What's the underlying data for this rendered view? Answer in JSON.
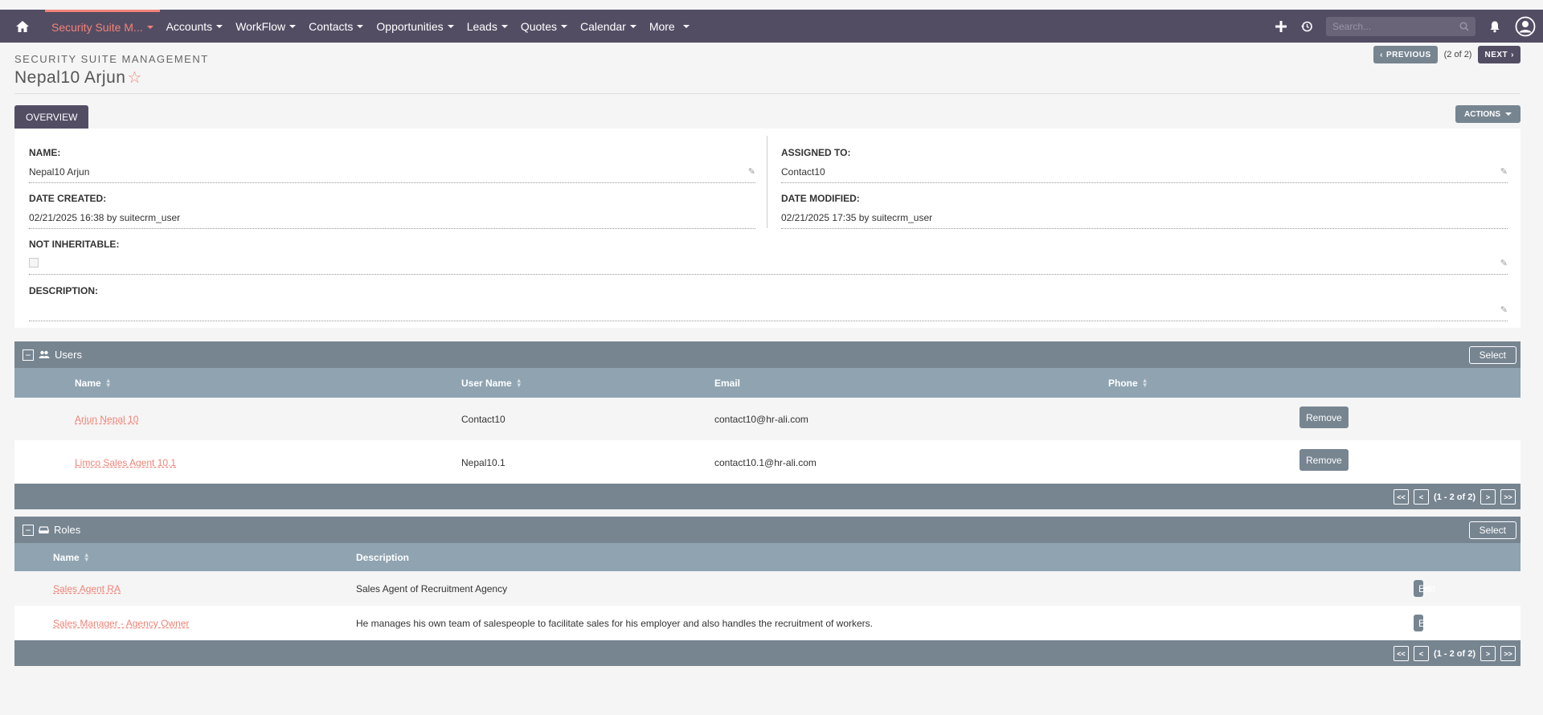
{
  "nav": {
    "items": [
      {
        "label": "Security Suite M...",
        "active": true
      },
      {
        "label": "Accounts"
      },
      {
        "label": "WorkFlow"
      },
      {
        "label": "Contacts"
      },
      {
        "label": "Opportunities"
      },
      {
        "label": "Leads"
      },
      {
        "label": "Quotes"
      },
      {
        "label": "Calendar"
      },
      {
        "label": "More"
      }
    ],
    "search_placeholder": "Search..."
  },
  "header": {
    "module": "SECURITY SUITE MANAGEMENT",
    "title": "Nepal10 Arjun",
    "previous": "PREVIOUS",
    "next": "NEXT",
    "count": "(2 of 2)"
  },
  "tabs": {
    "overview": "OVERVIEW",
    "actions": "ACTIONS"
  },
  "detail": {
    "name_label": "NAME:",
    "name_value": "Nepal10 Arjun",
    "assigned_label": "ASSIGNED TO:",
    "assigned_value": "Contact10",
    "created_label": "DATE CREATED:",
    "created_value": "02/21/2025 16:38 by suitecrm_user",
    "modified_label": "DATE MODIFIED:",
    "modified_value": "02/21/2025 17:35 by suitecrm_user",
    "noninherit_label": "NOT INHERITABLE:",
    "description_label": "DESCRIPTION:"
  },
  "users": {
    "title": "Users",
    "select": "Select",
    "columns": {
      "name": "Name",
      "username": "User Name",
      "email": "Email",
      "phone": "Phone"
    },
    "rows": [
      {
        "name": "Arjun Nepal 10",
        "username": "Contact10",
        "email": "contact10@hr-ali.com",
        "phone": "",
        "action": "Remove"
      },
      {
        "name": "Limco Sales Agent 10.1",
        "username": "Nepal10.1",
        "email": "contact10.1@hr-ali.com",
        "phone": "",
        "action": "Remove"
      }
    ],
    "pager": {
      "first": "<<",
      "prev": "<",
      "range": "(1 - 2 of 2)",
      "next": ">",
      "last": ">>"
    }
  },
  "roles": {
    "title": "Roles",
    "select": "Select",
    "columns": {
      "name": "Name",
      "description": "Description"
    },
    "rows": [
      {
        "name": "Sales Agent RA",
        "description": "Sales Agent of Recruitment Agency",
        "action": "Edit"
      },
      {
        "name": "Sales Manager - Agency Owner",
        "description": "He manages his own team of salespeople to facilitate sales for his employer and also handles the recruitment of workers.",
        "action": "Edit"
      }
    ],
    "pager": {
      "first": "<<",
      "prev": "<",
      "range": "(1 - 2 of 2)",
      "next": ">",
      "last": ">>"
    }
  },
  "colors": {
    "nav": "#534d64",
    "accent": "#f08377",
    "panel_header": "#778591",
    "column_header": "#8fa3b1"
  }
}
